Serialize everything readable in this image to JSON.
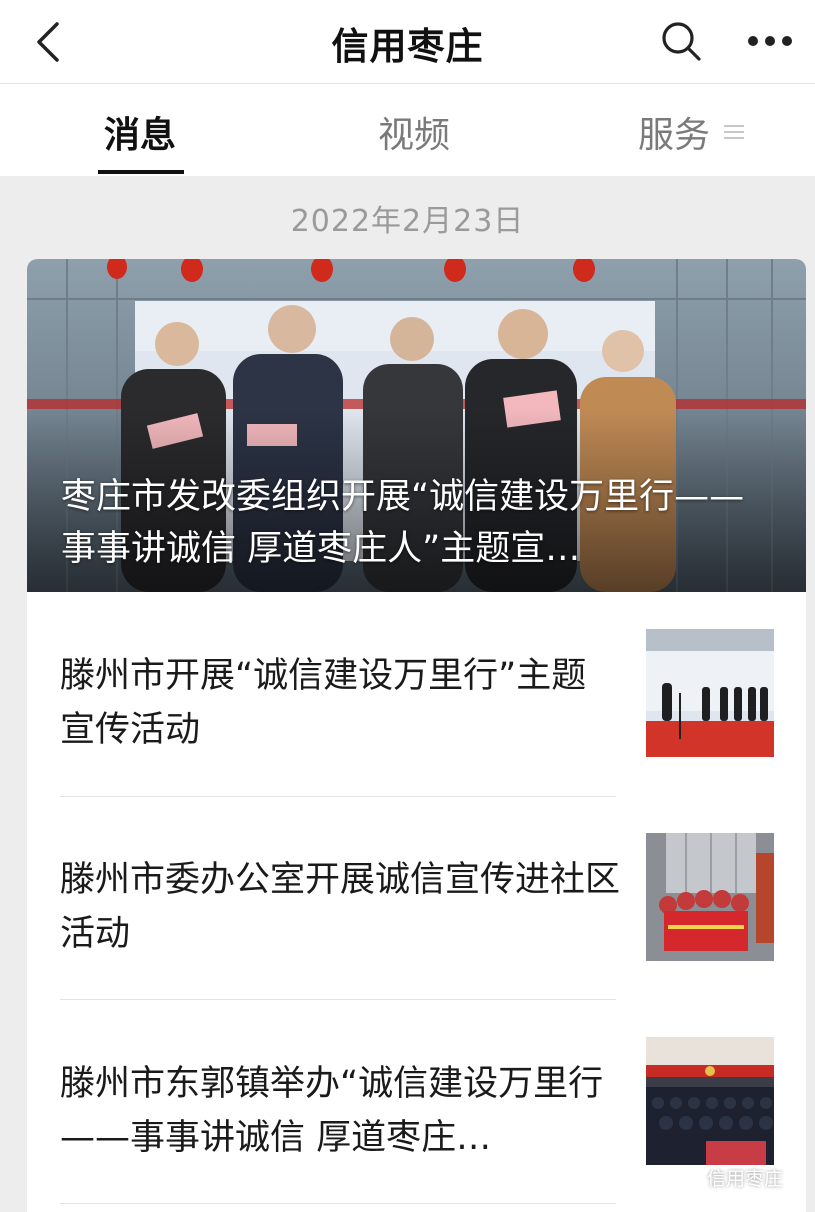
{
  "header": {
    "title": "信用枣庄",
    "icons": {
      "back": "chevron-left-icon",
      "search": "search-icon",
      "more": "more-dots-icon"
    }
  },
  "tabs": [
    {
      "label": "消息",
      "active": true
    },
    {
      "label": "视频",
      "active": false
    },
    {
      "label": "服务",
      "active": false
    }
  ],
  "feed": {
    "date": "2022年2月23日",
    "hero": {
      "title": "枣庄市发改委组织开展“诚信建设万里行——事事讲诚信 厚道枣庄人”主题宣…"
    },
    "items": [
      {
        "title": "滕州市开展“诚信建设万里行”主题宣传活动"
      },
      {
        "title": "滕州市委办公室开展诚信宣传进社区活动"
      },
      {
        "title": "滕州市东郭镇举办“诚信建设万里行——事事讲诚信 厚道枣庄…"
      }
    ]
  },
  "watermark": {
    "text": "信用枣庄",
    "icon": "wechat-icon"
  },
  "colors": {
    "background": "#ededed",
    "card": "#ffffff",
    "text": "#1a1a1a",
    "muted": "#9a9a9a",
    "banner_red": "#c8211f"
  }
}
